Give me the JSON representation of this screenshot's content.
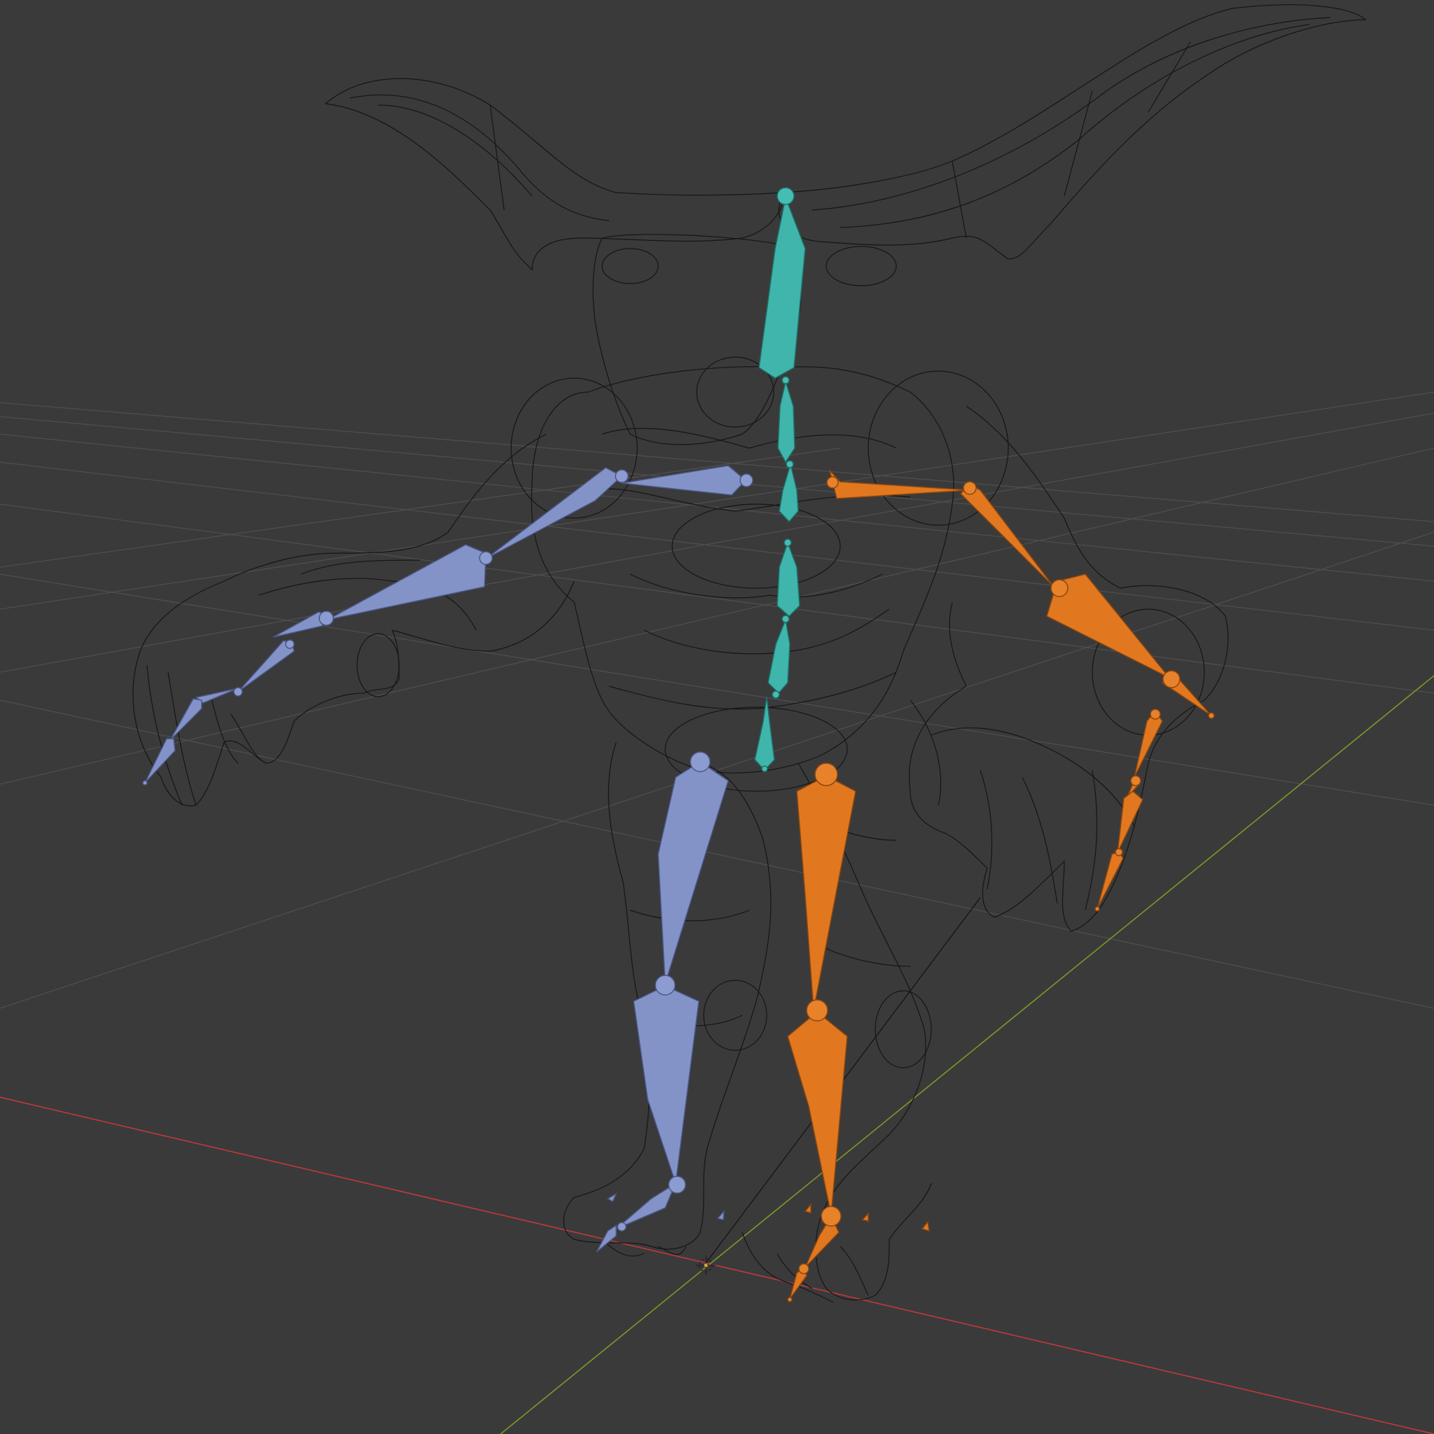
{
  "viewport": {
    "background_color": "#3a3a3a",
    "grid_color": "#555555",
    "x_axis_color": "#c0393b",
    "y_axis_color": "#7a9a2a",
    "mesh_wire_color": "#151515",
    "display_mode": "wireframe"
  },
  "armature": {
    "spine_color": "#3fb5ab",
    "left_side_color": "#8393c8",
    "right_side_color": "#e1781f",
    "bone_display": "octahedral"
  },
  "icons": {
    "origin": "3d-cursor-icon"
  }
}
